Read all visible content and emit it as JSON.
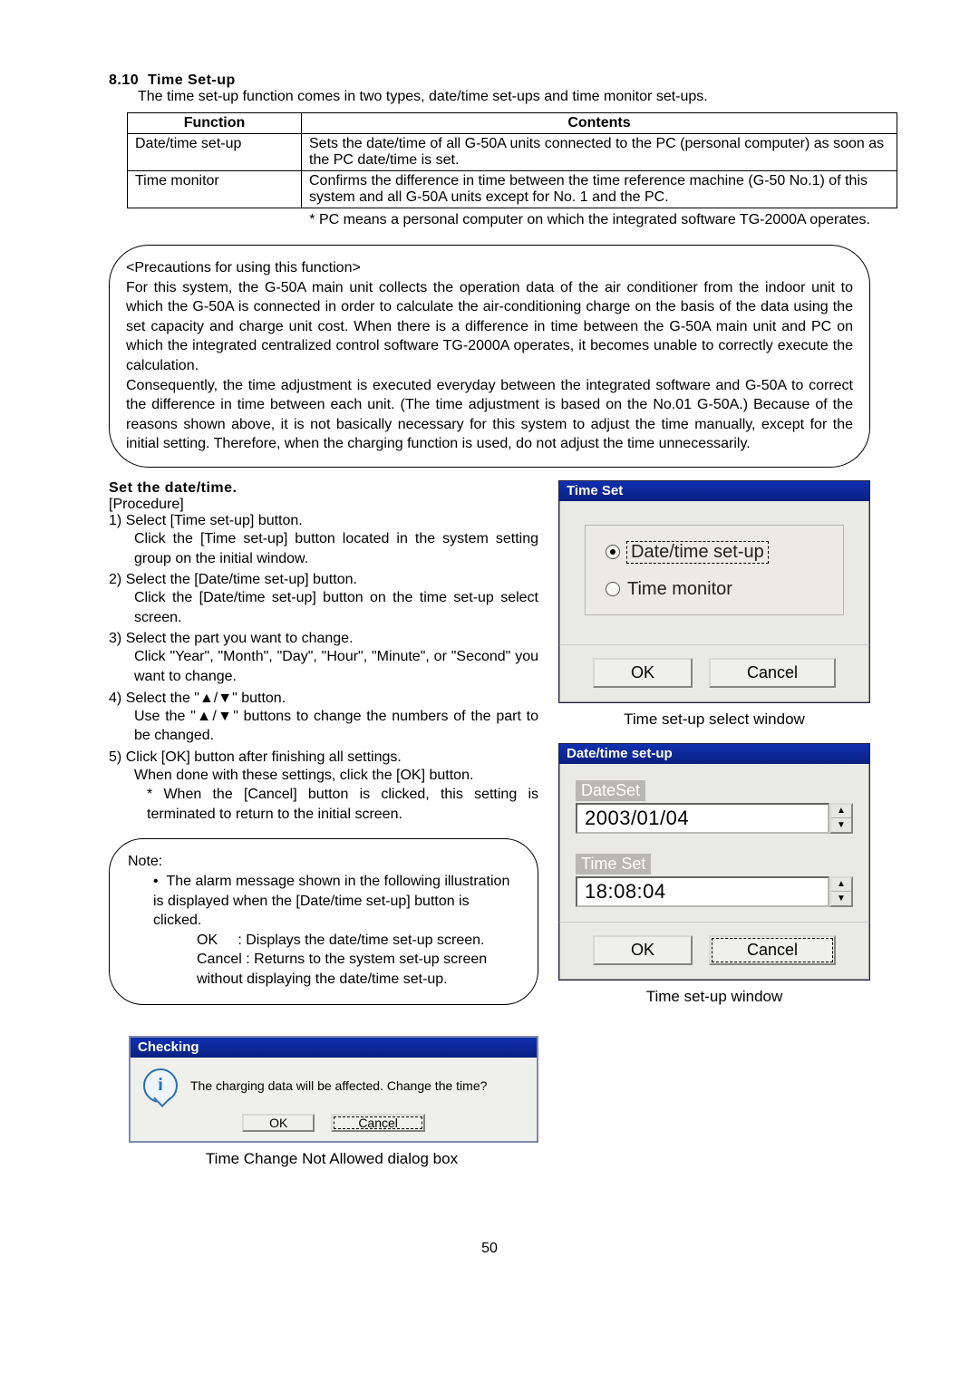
{
  "section": {
    "number": "8.10",
    "title": "Time Set-up",
    "intro": "The time set-up function comes in two types, date/time set-ups and time monitor set-ups."
  },
  "table": {
    "head_function": "Function",
    "head_contents": "Contents",
    "rows": [
      {
        "fn": "Date/time set-up",
        "desc": "Sets the date/time of all G-50A units connected to the PC (personal computer) as soon as the PC date/time is set."
      },
      {
        "fn": "Time monitor",
        "desc": "Confirms the difference in time between the time reference machine (G-50 No.1) of this system and all G-50A units except for No. 1 and the PC."
      }
    ],
    "footnote": "*    PC means a personal computer on which the integrated software TG-2000A operates."
  },
  "precautions": {
    "heading": "<Precautions for using this function>",
    "p1": "For this system, the G-50A main unit collects the operation data of the air conditioner from the indoor unit to which the G-50A is connected in order to calculate the air-conditioning charge on the basis of the data using the set capacity and charge unit cost. When there is a difference in time between the G-50A main unit and PC on which the integrated centralized control software TG-2000A operates, it becomes unable to correctly execute the calculation.",
    "p2": "Consequently, the time adjustment is executed everyday between the integrated software and G-50A to correct the difference in time between each unit. (The time adjustment is based on the No.01 G-50A.) Because of the reasons shown above, it is not basically necessary for this system to adjust the time manually, except for the initial setting. Therefore, when the charging function is used, do not adjust the time unnecessarily."
  },
  "procedure": {
    "title": "Set the date/time.",
    "label": "[Procedure]",
    "steps": [
      {
        "n": "1)",
        "head": "Select [Time set-up] button.",
        "body": "Click the [Time set-up] button located in the system setting group on the initial window."
      },
      {
        "n": "2)",
        "head": "Select the [Date/time set-up] button.",
        "body": "Click the [Date/time set-up] button on the time set-up select screen."
      },
      {
        "n": "3)",
        "head": "Select the part you want to change.",
        "body": "Click \"Year\", \"Month\", \"Day\", \"Hour\", \"Minute\", or \"Second\" you want to change."
      },
      {
        "n": "4)",
        "head": "Select the \"▲/▼\" button.",
        "body": "Use the \"▲/▼\" buttons to change the numbers of the part to be changed."
      },
      {
        "n": "5)",
        "head": "Click [OK] button after finishing all settings.",
        "body": "When done with these settings, click the [OK] button.",
        "sub": "*   When the [Cancel] button is clicked, this setting is terminated to return to the initial screen."
      }
    ]
  },
  "note": {
    "heading": "Note:",
    "bullet": "The alarm message shown in the following illustration is displayed when the [Date/time set-up] button is clicked.",
    "ok_lbl": "OK",
    "ok_desc": ": Displays the date/time set-up screen.",
    "cancel_lbl": "Cancel",
    "cancel_desc": ": Returns to the system set-up screen without displaying the date/time set-up."
  },
  "win_select": {
    "title": "Time Set",
    "opt1": "Date/time set-up",
    "opt2": "Time monitor",
    "ok": "OK",
    "cancel": "Cancel",
    "caption": "Time set-up select window"
  },
  "win_datetime": {
    "title": "Date/time set-up",
    "date_label": "DateSet",
    "date_value": "2003/01/04",
    "time_label": "Time Set",
    "time_value": "18:08:04",
    "ok": "OK",
    "cancel": "Cancel",
    "caption": "Time set-up window"
  },
  "dlg_check": {
    "title": "Checking",
    "message": "The charging data will be affected. Change the time?",
    "ok": "OK",
    "cancel": "Cancel",
    "caption": "Time Change Not Allowed dialog box"
  },
  "page_number": "50",
  "glyphs": {
    "up": "▲",
    "down": "▼",
    "bullet": "•",
    "info": "i"
  }
}
